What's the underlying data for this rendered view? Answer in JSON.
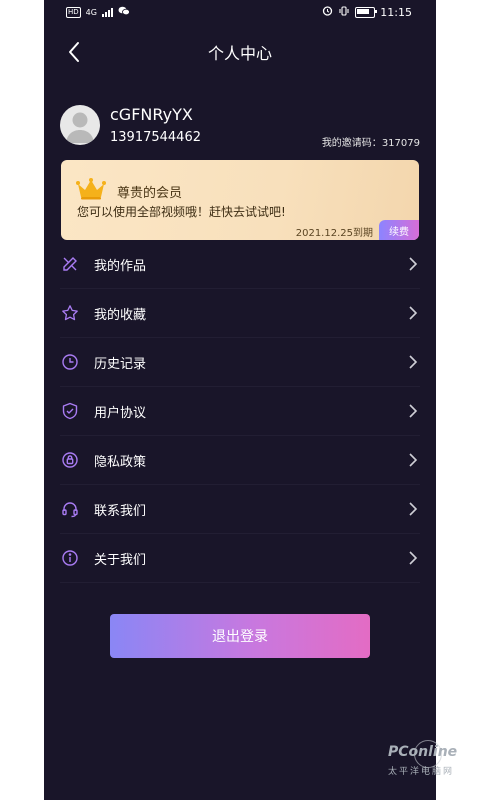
{
  "status_bar": {
    "hd": "HD",
    "network": "4G",
    "time": "11:15"
  },
  "nav": {
    "title": "个人中心"
  },
  "profile": {
    "username": "cGFNRyYX",
    "phone": "13917544462",
    "invite_label": "我的邀请码：",
    "invite_code": "317079"
  },
  "vip": {
    "title": "尊贵的会员",
    "description": "您可以使用全部视频哦！赶快去试试吧!",
    "expire": "2021.12.25到期",
    "renew_label": "续费"
  },
  "menu": [
    {
      "label": "我的作品",
      "icon": "pencil-ruler-icon"
    },
    {
      "label": "我的收藏",
      "icon": "star-icon"
    },
    {
      "label": "历史记录",
      "icon": "clock-icon"
    },
    {
      "label": "用户协议",
      "icon": "shield-check-icon"
    },
    {
      "label": "隐私政策",
      "icon": "privacy-icon"
    },
    {
      "label": "联系我们",
      "icon": "headset-icon"
    },
    {
      "label": "关于我们",
      "icon": "info-icon"
    }
  ],
  "logout_label": "退出登录",
  "watermark": {
    "main": "PConline",
    "sub": "太平洋电脑网"
  },
  "colors": {
    "background": "#191529",
    "accent_icon": "#a97cf3",
    "gradient_start": "#8a86f5",
    "gradient_end": "#e36cc4",
    "card": "#fbe6c5"
  }
}
